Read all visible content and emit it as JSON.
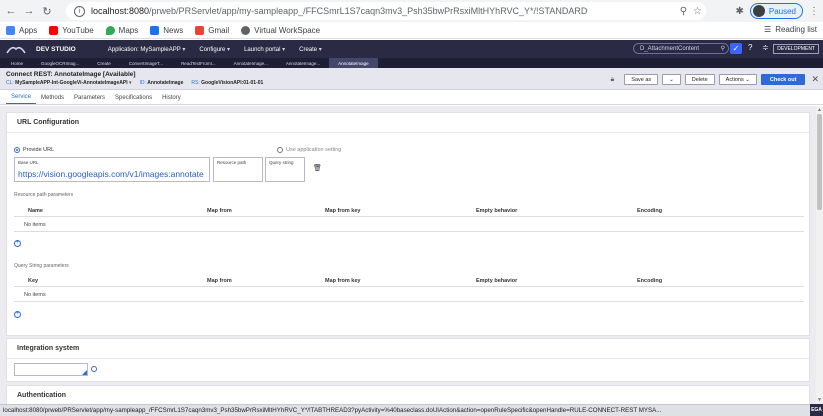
{
  "browser": {
    "url_host": "localhost:8080",
    "url_path": "/prweb/PRServlet/app/my-sampleapp_/FFCSmrL1S7caqn3mv3_Psh35bwPrRsxiMltHYhRVC_Y*/!STANDARD",
    "profile_label": "Paused",
    "reading_list": "Reading list",
    "status_url": "localhost:8080/prweb/PRServlet/app/my-sampleapp_/FFCSmrL1S7caqn3mv3_Psh35bwPrRsxiMltHYhRVC_Y*/!TABTHREAD3?pyActivity=%40baseclass.doUIAction&action=openRuleSpecific&openHandle=RULE-CONNECT-REST MYSA...",
    "corner_badge": "EGA"
  },
  "bookmarks": [
    {
      "label": "Apps",
      "color": "#4285f4"
    },
    {
      "label": "YouTube",
      "color": "#ff0000"
    },
    {
      "label": "Maps",
      "color": "#34a853"
    },
    {
      "label": "News",
      "color": "#1a73e8"
    },
    {
      "label": "Gmail",
      "color": "#ea4335"
    },
    {
      "label": "Virtual WorkSpace",
      "color": "#5f6368"
    }
  ],
  "pega": {
    "studio": "DEV STUDIO",
    "menu": [
      "Application: MySampleAPP",
      "Configure",
      "Launch portal",
      "Create"
    ],
    "search_value": "D_AttachmentContent",
    "portal_label": "DEVELOPMENT",
    "tabs": [
      "Home",
      "GoogleOCRImag...",
      "Create",
      "ConvertImageT...",
      "ReadTextFromI...",
      "AnnotateImage...",
      "AnnotateImage...",
      "AnnotateImage"
    ]
  },
  "rule": {
    "title": "Connect REST: AnnotateImage [Available]",
    "cl_key": "CL:",
    "cl_value": "MySampleAPP-Int-GoogleVi-AnnotateImageAPI",
    "id_key": "ID:",
    "id_value": "AnnotateImage",
    "rs_key": "RS:",
    "rs_value": "GoogleVisionAPI:01-01-01",
    "save_as": "Save as",
    "delete": "Delete",
    "actions": "Actions",
    "check_out": "Check out",
    "tabs": [
      "Service",
      "Methods",
      "Parameters",
      "Specifications",
      "History"
    ]
  },
  "url_config": {
    "title": "URL Configuration",
    "provide_url": "Provide URL",
    "use_app_setting": "Use application setting",
    "base_url_label": "Base URL",
    "base_url_value": "https://vision.googleapis.com/v1/images:annotate",
    "resource_path_label": "Resource path",
    "query_string_label": "Query string",
    "resource_params_label": "Resource path parameters",
    "resource_cols": [
      "Name",
      "Map from",
      "Map from key",
      "Empty behavior",
      "Encoding"
    ],
    "query_params_label": "Query String parameters",
    "query_cols": [
      "Key",
      "Map from",
      "Map from key",
      "Empty behavior",
      "Encoding"
    ],
    "no_items": "No items"
  },
  "integration": {
    "title": "Integration system"
  },
  "authentication": {
    "title": "Authentication"
  }
}
